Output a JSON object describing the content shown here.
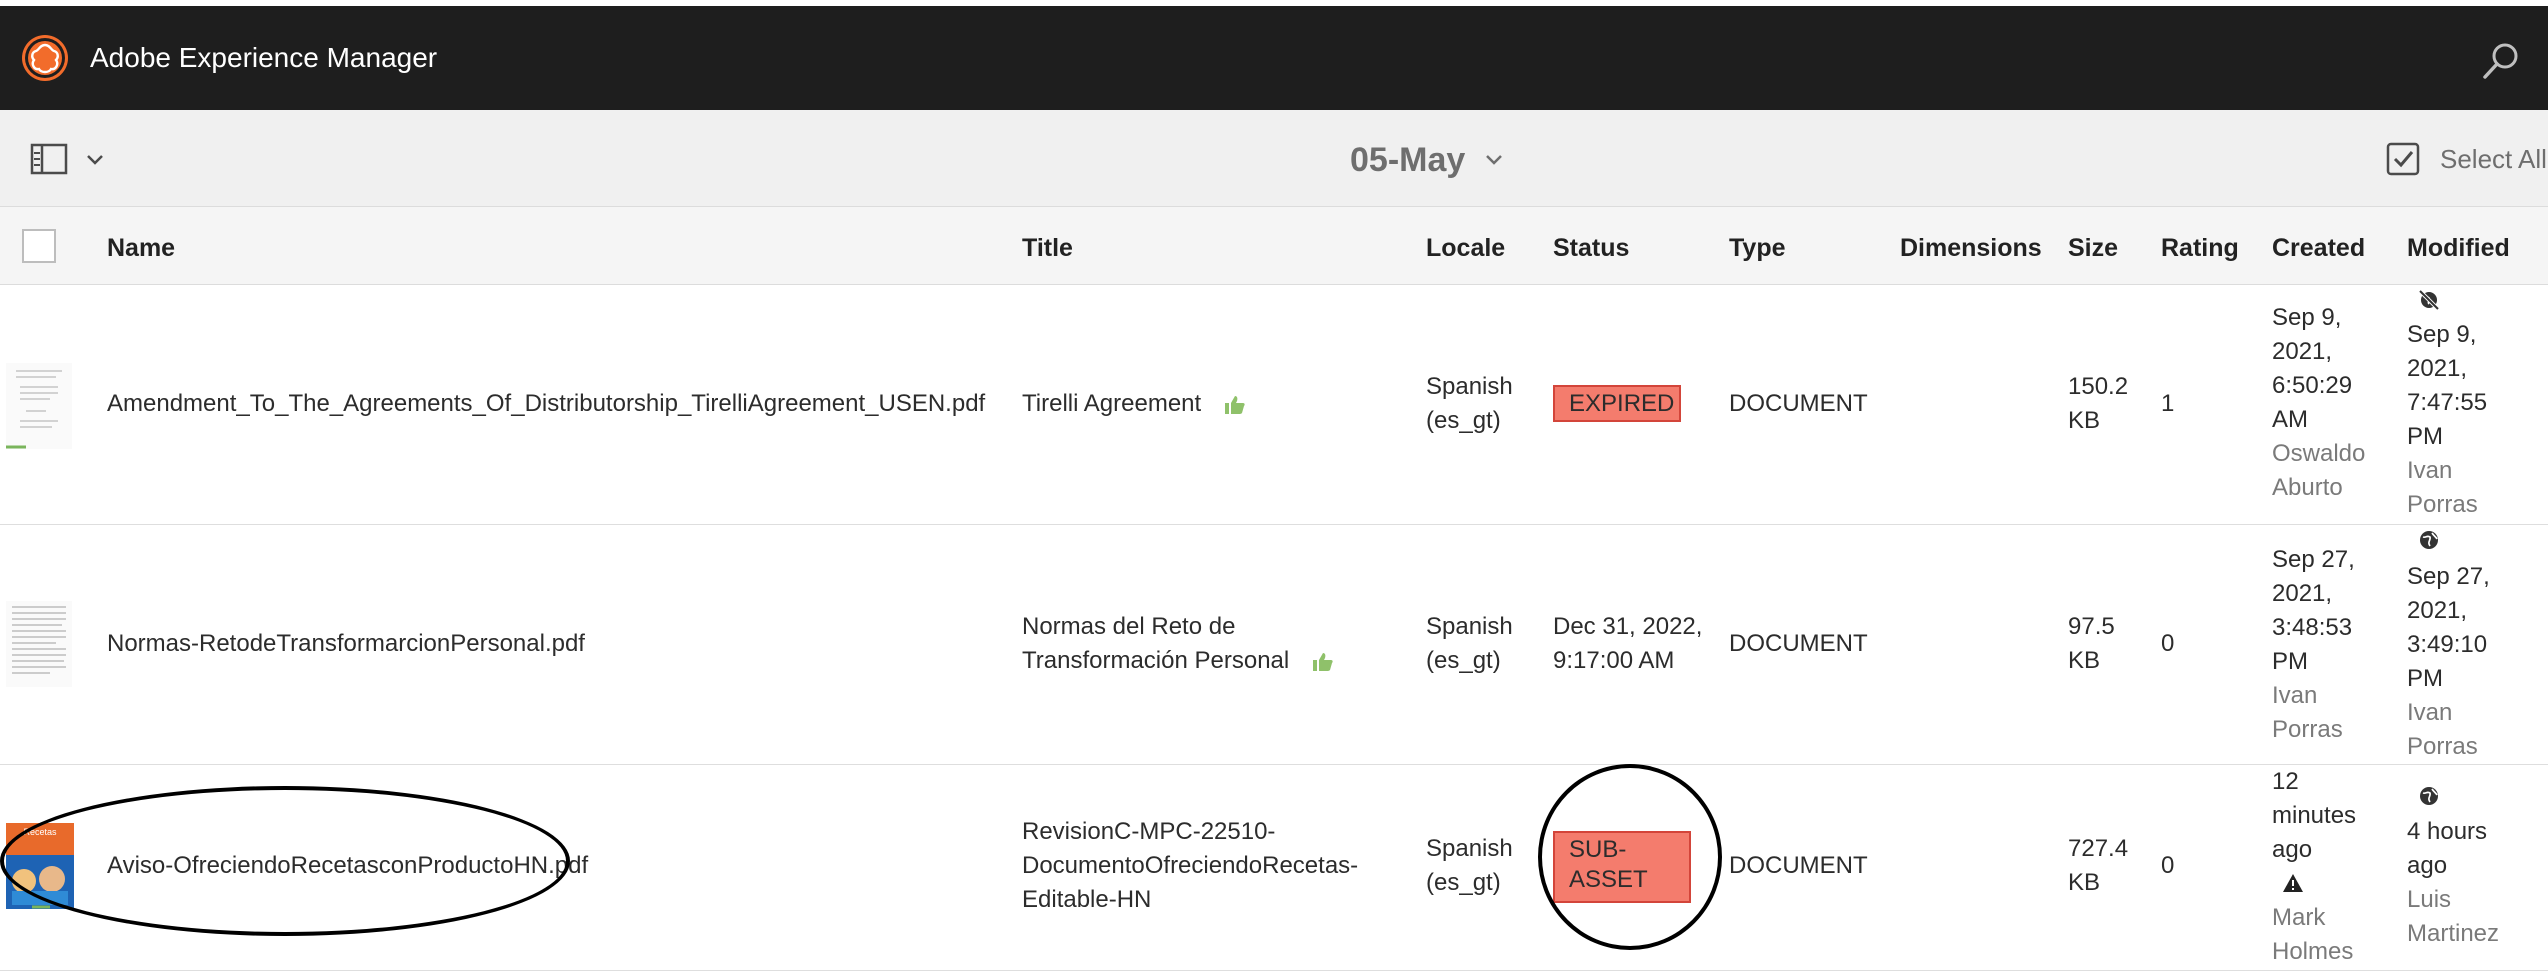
{
  "header": {
    "app_title": "Adobe Experience Manager"
  },
  "toolbar": {
    "folder_title": "05-May",
    "select_all_label": "Select All"
  },
  "columns": {
    "name": "Name",
    "title": "Title",
    "locale": "Locale",
    "status": "Status",
    "type": "Type",
    "dimensions": "Dimensions",
    "size": "Size",
    "rating": "Rating",
    "created": "Created",
    "modified": "Modified"
  },
  "rows": [
    {
      "name": "Amendment_To_The_Agreements_Of_Distributorship_TirelliAgreement_USEN.pdf",
      "title_lines": [
        "Tirelli Agreement"
      ],
      "locale_lines": [
        "Spanish",
        "(es_gt)"
      ],
      "status": "EXPIRED",
      "type": "DOCUMENT",
      "size_lines": [
        "150.2",
        "KB"
      ],
      "rating": "1",
      "created_lines": [
        "Sep 9,",
        "2021,",
        "6:50:29",
        "AM"
      ],
      "created_by_lines": [
        "Oswaldo",
        "Aburto"
      ],
      "modified_lines": [
        "Sep 9,",
        "2021,",
        "7:47:55",
        "PM"
      ],
      "modified_by_lines": [
        "Ivan",
        "Porras"
      ]
    },
    {
      "name": "Normas-RetodeTransformarcionPersonal.pdf",
      "title_lines": [
        "Normas del Reto de",
        "Transformación Personal"
      ],
      "locale_lines": [
        "Spanish",
        "(es_gt)"
      ],
      "status_lines": [
        "Dec 31, 2022,",
        "9:17:00 AM"
      ],
      "type": "DOCUMENT",
      "size_lines": [
        "97.5",
        "KB"
      ],
      "rating": "0",
      "created_lines": [
        "Sep 27,",
        "2021,",
        "3:48:53",
        "PM"
      ],
      "created_by_lines": [
        "Ivan",
        "Porras"
      ],
      "modified_lines": [
        "Sep 27,",
        "2021,",
        "3:49:10",
        "PM"
      ],
      "modified_by_lines": [
        "Ivan",
        "Porras"
      ]
    },
    {
      "name": "Aviso-OfreciendoRecetasconProductoHN.pdf",
      "title_lines": [
        "RevisionC-MPC-22510-",
        "DocumentoOfreciendoRecetas-",
        "Editable-HN"
      ],
      "locale_lines": [
        "Spanish",
        "(es_gt)"
      ],
      "status_lines": [
        "SUB-",
        "ASSET"
      ],
      "type": "DOCUMENT",
      "size_lines": [
        "727.4",
        "KB"
      ],
      "rating": "0",
      "created_lines": [
        "12",
        "minutes",
        "ago"
      ],
      "created_by_lines": [
        "Mark",
        "Holmes"
      ],
      "modified_lines": [
        "4 hours",
        "ago"
      ],
      "modified_by_lines": [
        "Luis",
        "Martinez"
      ]
    }
  ],
  "thumbnail_label": "Recetas",
  "colors": {
    "topbar": "#1e1e1e",
    "logo_accent": "#f26c2b",
    "badge_red": "#f47c6d",
    "thumb_green": "#7ab55c"
  }
}
